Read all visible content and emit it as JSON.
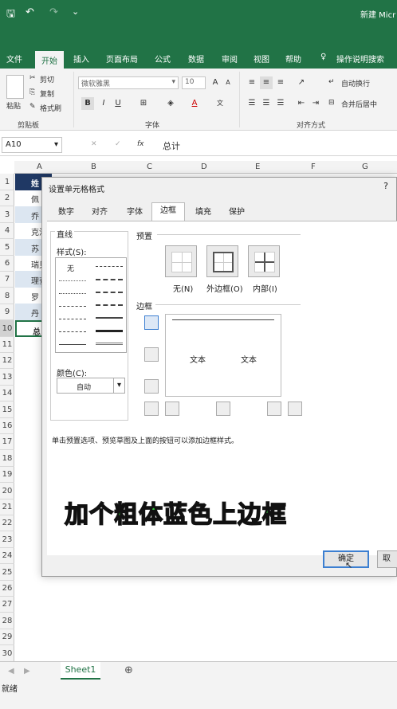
{
  "window": {
    "title": "新建 Micr"
  },
  "ribbon_tabs": [
    "文件",
    "开始",
    "插入",
    "页面布局",
    "公式",
    "数据",
    "审阅",
    "视图",
    "帮助"
  ],
  "tell_me": "操作说明搜索",
  "clipboard": {
    "paste": "粘贴",
    "cut": "剪切",
    "copy": "复制",
    "format_painter": "格式刷",
    "group": "剪贴板"
  },
  "font": {
    "name": "微软雅黑",
    "size": "10",
    "group": "字体",
    "bold": "B",
    "italic": "I",
    "underline": "U"
  },
  "alignment": {
    "wrap": "自动换行",
    "merge": "合并后居中",
    "group": "对齐方式"
  },
  "formula_bar": {
    "name_box": "A10",
    "fx": "fx",
    "value": "总计"
  },
  "columns": [
    "A",
    "B",
    "C",
    "D",
    "E",
    "F",
    "G"
  ],
  "rows": [
    "1",
    "2",
    "3",
    "4",
    "5",
    "6",
    "7",
    "8",
    "9",
    "10",
    "11",
    "12",
    "13",
    "14",
    "15",
    "16",
    "17",
    "18",
    "19",
    "20",
    "21",
    "22",
    "23",
    "24",
    "25",
    "26",
    "27",
    "28",
    "29",
    "30"
  ],
  "cells_a": [
    "姓",
    "佩",
    "乔",
    "克洛",
    "苏",
    "瑞贝",
    "理查",
    "罗",
    "丹",
    "总"
  ],
  "sheet": {
    "tab": "Sheet1",
    "add": "⊕",
    "status": "就绪"
  },
  "dialog": {
    "title": "设置单元格格式",
    "help": "?",
    "tabs": [
      "数字",
      "对齐",
      "字体",
      "边框",
      "填充",
      "保护"
    ],
    "active_tab": "边框",
    "line_section": "直线",
    "style_label": "样式(S):",
    "none_label": "无",
    "color_label": "颜色(C):",
    "color_value": "自动",
    "presets_section": "预置",
    "presets": [
      "无(N)",
      "外边框(O)",
      "内部(I)"
    ],
    "border_section": "边框",
    "preview_text": [
      "文本",
      "文本"
    ],
    "hint": "单击预置选项、预览草图及上面的按钮可以添加边框样式。",
    "ok": "确定",
    "cancel": "取"
  },
  "overlay_caption": "加个粗体蓝色上边框",
  "colors": {
    "excel_green": "#217346",
    "caption_green": "#2fc43a",
    "header_navy": "#1f3864"
  }
}
